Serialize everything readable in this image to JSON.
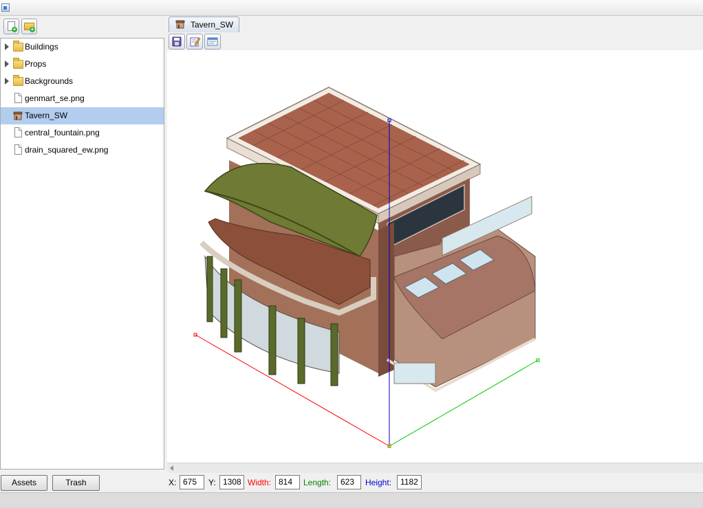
{
  "tree": {
    "items": [
      {
        "label": "Buildings",
        "kind": "folder"
      },
      {
        "label": "Props",
        "kind": "folder"
      },
      {
        "label": "Backgrounds",
        "kind": "folder"
      },
      {
        "label": "genmart_se.png",
        "kind": "file"
      },
      {
        "label": "Tavern_SW",
        "kind": "building",
        "selected": true
      },
      {
        "label": "central_fountain.png",
        "kind": "file"
      },
      {
        "label": "drain_squared_ew.png",
        "kind": "file"
      }
    ]
  },
  "left_toolbar": {
    "new_file_icon": "new-document-icon",
    "new_folder_icon": "new-folder-icon"
  },
  "bottom_tabs": {
    "assets_label": "Assets",
    "trash_label": "Trash"
  },
  "editor": {
    "tab_label": "Tavern_SW",
    "toolbar_icons": [
      "save-icon",
      "edit-icon",
      "properties-icon"
    ]
  },
  "coords": {
    "x_label": "X:",
    "x_value": "675",
    "y_label": "Y:",
    "y_value": "1308",
    "width_label": "Width:",
    "width_value": "814",
    "length_label": "Length:",
    "length_value": "623",
    "height_label": "Height:",
    "height_value": "1182"
  },
  "colors": {
    "selection": "#b3cdef",
    "width_axis": "#ff0000",
    "length_axis": "#00c800",
    "height_axis": "#0000cc"
  }
}
